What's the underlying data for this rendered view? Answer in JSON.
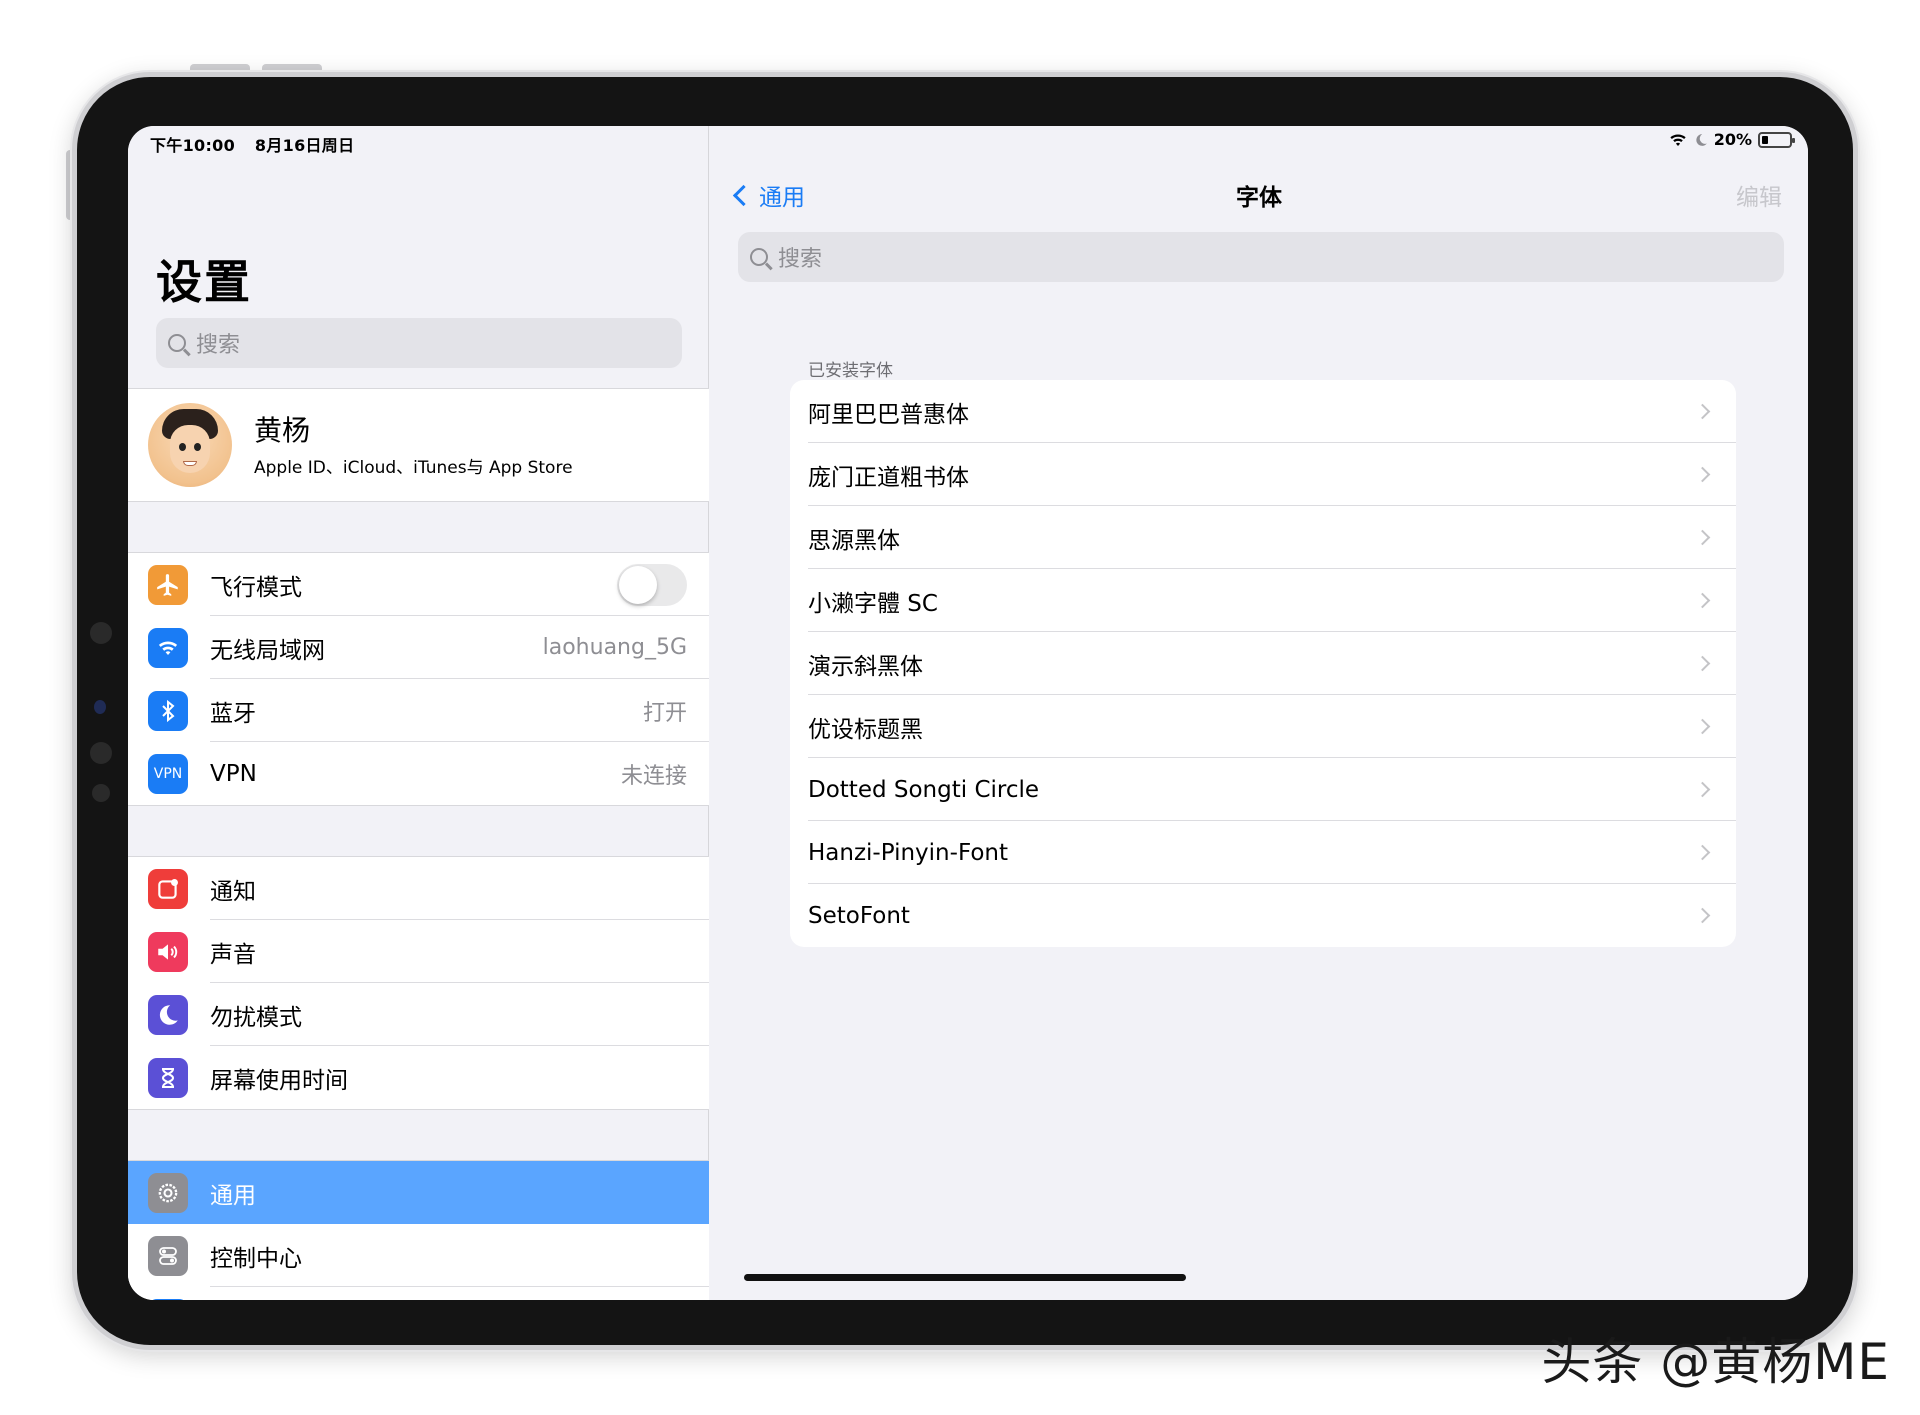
{
  "status_bar": {
    "time": "下午10:00",
    "date": "8月16日周日",
    "battery": "20%",
    "battery_level": 0.2
  },
  "sidebar": {
    "title": "设置",
    "search_placeholder": "搜索",
    "profile": {
      "name": "黄杨",
      "subtitle": "Apple ID、iCloud、iTunes与 App Store"
    },
    "group1": [
      {
        "label": "飞行模式",
        "icon": "airplane-icon",
        "color": "#f19a37",
        "toggle": false
      },
      {
        "label": "无线局域网",
        "icon": "wifi-icon",
        "color": "#1a7cf5",
        "value": "laohuang_5G"
      },
      {
        "label": "蓝牙",
        "icon": "bluetooth-icon",
        "color": "#1a7cf5",
        "value": "打开"
      },
      {
        "label": "VPN",
        "icon": "vpn-icon",
        "icon_text": "VPN",
        "color": "#1a7cf5",
        "value": "未连接"
      }
    ],
    "group2": [
      {
        "label": "通知",
        "icon": "notifications-icon",
        "color": "#ef3d3a"
      },
      {
        "label": "声音",
        "icon": "sound-icon",
        "color": "#ef3a5d"
      },
      {
        "label": "勿扰模式",
        "icon": "moon-icon",
        "color": "#5b50d6"
      },
      {
        "label": "屏幕使用时间",
        "icon": "hourglass-icon",
        "color": "#5b50d6"
      }
    ],
    "group3": [
      {
        "label": "通用",
        "icon": "gear-icon",
        "color": "#8e8e93",
        "selected": true
      },
      {
        "label": "控制中心",
        "icon": "control-center-icon",
        "color": "#8e8e93"
      }
    ]
  },
  "detail": {
    "back_label": "通用",
    "title": "字体",
    "edit_label": "编辑",
    "search_placeholder": "搜索",
    "section_header": "已安装字体",
    "fonts": [
      "阿里巴巴普惠体",
      "庞门正道粗书体",
      "思源黑体",
      "小濑字體 SC",
      "演示斜黑体",
      "优设标题黑",
      "Dotted Songti Circle",
      "Hanzi-Pinyin-Font",
      "SetoFont"
    ]
  },
  "watermark": "头条 @黄杨ME"
}
